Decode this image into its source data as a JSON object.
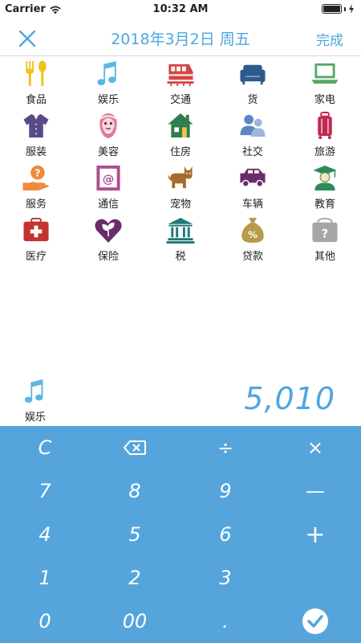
{
  "status": {
    "carrier": "Carrier",
    "time": "10:32 AM"
  },
  "nav": {
    "title": "2018年3月2日 周五",
    "done": "完成"
  },
  "categories": [
    {
      "label": "食品"
    },
    {
      "label": "娱乐"
    },
    {
      "label": "交通"
    },
    {
      "label": "货"
    },
    {
      "label": "家电"
    },
    {
      "label": "服装"
    },
    {
      "label": "美容"
    },
    {
      "label": "住房"
    },
    {
      "label": "社交"
    },
    {
      "label": "旅游"
    },
    {
      "label": "服务"
    },
    {
      "label": "通信"
    },
    {
      "label": "宠物"
    },
    {
      "label": "车辆"
    },
    {
      "label": "教育"
    },
    {
      "label": "医疗"
    },
    {
      "label": "保险"
    },
    {
      "label": "税"
    },
    {
      "label": "贷款"
    },
    {
      "label": "其他"
    }
  ],
  "selected": {
    "label": "娱乐"
  },
  "amount": "5,010",
  "keypad": {
    "clear": "C",
    "divide": "÷",
    "multiply": "×",
    "seven": "7",
    "eight": "8",
    "nine": "9",
    "minus": "—",
    "four": "4",
    "five": "5",
    "six": "6",
    "plus": "+",
    "one": "1",
    "two": "2",
    "three": "3",
    "zero": "0",
    "double_zero": "00",
    "dot": "."
  },
  "colors": {
    "accent": "#4ea6e0",
    "keypad_bg": "#55a5dc"
  }
}
